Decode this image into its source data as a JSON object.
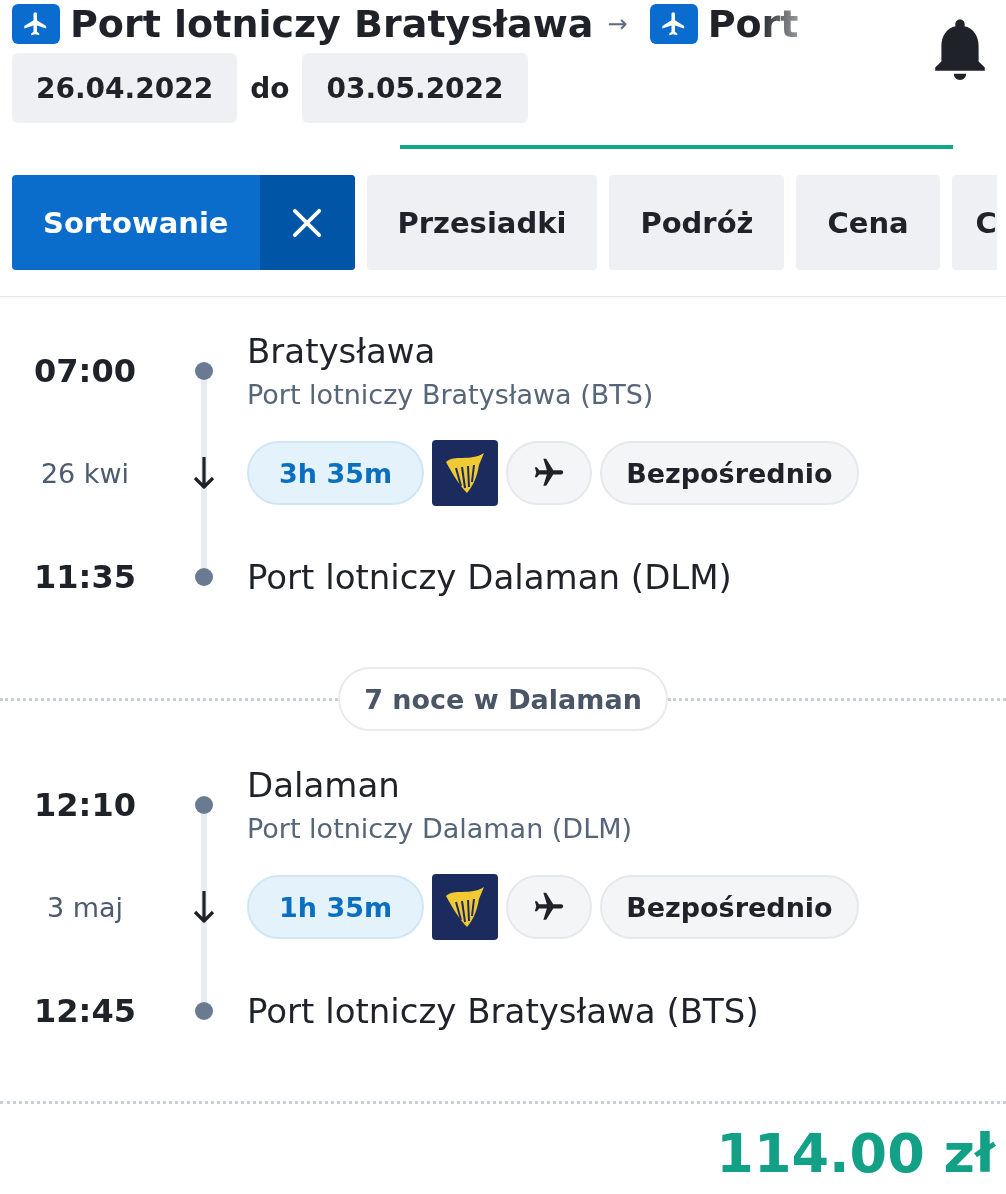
{
  "header": {
    "origin": "Port lotniczy Bratysława",
    "arrow": "→",
    "destination": "Port"
  },
  "dates": {
    "from": "26.04.2022",
    "separator": "do",
    "to": "03.05.2022"
  },
  "filters": [
    {
      "label": "Sortowanie",
      "selected": true,
      "clearable": true
    },
    {
      "label": "Przesiadki",
      "selected": false,
      "clearable": false
    },
    {
      "label": "Podróż",
      "selected": false,
      "clearable": false
    },
    {
      "label": "Cena",
      "selected": false,
      "clearable": false
    },
    {
      "label": "C",
      "selected": false,
      "clearable": false
    }
  ],
  "itinerary": [
    {
      "kind": "leg",
      "departure_time": "07:00",
      "city": "Bratysława",
      "departure_airport": "Port lotniczy Bratysława (BTS)",
      "date": "26 kwi",
      "duration": "3h 35m",
      "stops": "Bezpośrednio",
      "arrival_time": "11:35",
      "arrival_airport": "Port lotniczy Dalaman (DLM)"
    },
    {
      "kind": "stay",
      "label": "7 noce w Dalaman"
    },
    {
      "kind": "leg",
      "departure_time": "12:10",
      "city": "Dalaman",
      "departure_airport": "Port lotniczy Dalaman (DLM)",
      "date": "3 maj",
      "duration": "1h 35m",
      "stops": "Bezpośrednio",
      "arrival_time": "12:45",
      "arrival_airport": "Port lotniczy Bratysława (BTS)"
    }
  ],
  "price": "114.00 zł"
}
